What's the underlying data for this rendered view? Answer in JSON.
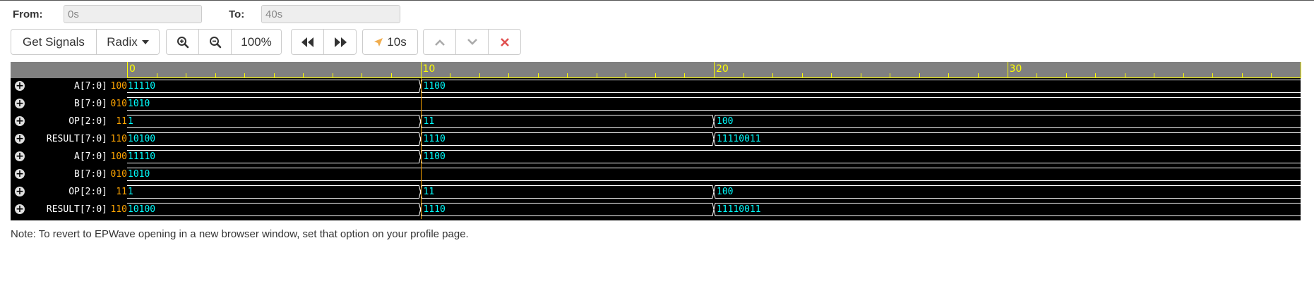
{
  "range": {
    "from_label": "From:",
    "from_value": "0s",
    "to_label": "To:",
    "to_value": "40s"
  },
  "toolbar": {
    "get_signals": "Get Signals",
    "radix": "Radix",
    "zoom_level": "100%",
    "cursor_time": "10s"
  },
  "ruler": {
    "labels": [
      "0",
      "10",
      "20",
      "30"
    ],
    "max_time": 40
  },
  "signals": [
    {
      "name": "A[7:0]",
      "value": "100",
      "segments": [
        {
          "t0": 0,
          "t1": 10,
          "label": "11110"
        },
        {
          "t0": 10,
          "t1": 40,
          "label": "1100"
        }
      ]
    },
    {
      "name": "B[7:0]",
      "value": "010",
      "segments": [
        {
          "t0": 0,
          "t1": 40,
          "label": "1010"
        }
      ]
    },
    {
      "name": "OP[2:0]",
      "value": "11",
      "segments": [
        {
          "t0": 0,
          "t1": 10,
          "label": "1"
        },
        {
          "t0": 10,
          "t1": 20,
          "label": "11"
        },
        {
          "t0": 20,
          "t1": 40,
          "label": "100"
        }
      ]
    },
    {
      "name": "RESULT[7:0]",
      "value": "110",
      "segments": [
        {
          "t0": 0,
          "t1": 10,
          "label": "10100"
        },
        {
          "t0": 10,
          "t1": 20,
          "label": "1110"
        },
        {
          "t0": 20,
          "t1": 40,
          "label": "11110011"
        }
      ]
    },
    {
      "name": "A[7:0]",
      "value": "100",
      "segments": [
        {
          "t0": 0,
          "t1": 10,
          "label": "11110"
        },
        {
          "t0": 10,
          "t1": 40,
          "label": "1100"
        }
      ]
    },
    {
      "name": "B[7:0]",
      "value": "010",
      "segments": [
        {
          "t0": 0,
          "t1": 40,
          "label": "1010"
        }
      ]
    },
    {
      "name": "OP[2:0]",
      "value": "11",
      "segments": [
        {
          "t0": 0,
          "t1": 10,
          "label": "1"
        },
        {
          "t0": 10,
          "t1": 20,
          "label": "11"
        },
        {
          "t0": 20,
          "t1": 40,
          "label": "100"
        }
      ]
    },
    {
      "name": "RESULT[7:0]",
      "value": "110",
      "segments": [
        {
          "t0": 0,
          "t1": 10,
          "label": "10100"
        },
        {
          "t0": 10,
          "t1": 20,
          "label": "1110"
        },
        {
          "t0": 20,
          "t1": 40,
          "label": "11110011"
        }
      ]
    }
  ],
  "note": "Note: To revert to EPWave opening in a new browser window, set that option on your profile page.",
  "colors": {
    "wave_bg": "#000000",
    "trace": "#ffffff",
    "segment_text": "#00ffff",
    "value_text": "#ffa500",
    "ruler": "#ffff00",
    "cursor": "#ffa500",
    "delete_icon": "#e05050",
    "cursor_icon": "#f0ad4e"
  }
}
